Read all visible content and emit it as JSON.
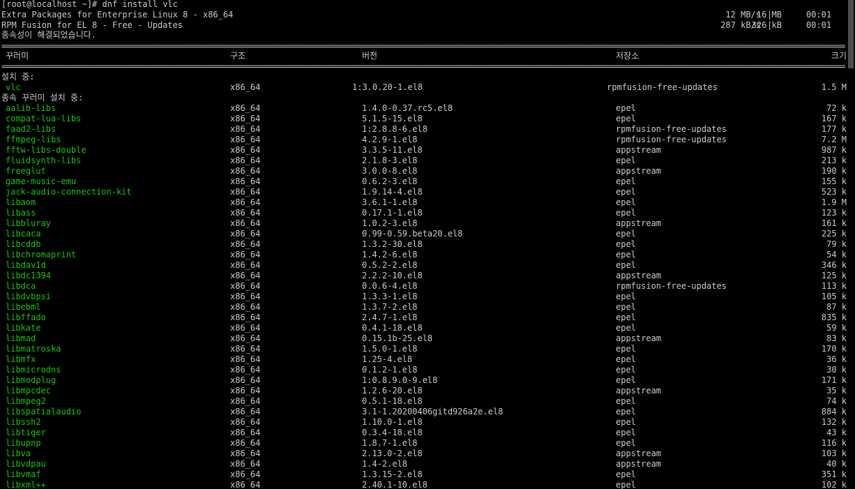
{
  "prompt": "[root@localhost ~]# dnf install vlc",
  "repos": [
    {
      "name": "Extra Packages for Enterprise Linux 8 - x86_64",
      "speed": "12 MB/s",
      "size": "16 MB",
      "time": "00:01"
    },
    {
      "name": "RPM Fusion for EL 8 - Free - Updates",
      "speed": "287 kB/s",
      "size": "326 kB",
      "time": "00:01"
    }
  ],
  "resolved": "종속성이 해결되었습니다.",
  "separator": "================================================================================================================================================================================================================================",
  "headers": {
    "package": "꾸러미",
    "arch": "구조",
    "version": "버전",
    "repo": "저장소",
    "size": "크기"
  },
  "installing_label": "설치 중:",
  "main_package": {
    "name": "vlc",
    "arch": "x86_64",
    "version": "1:3.0.20-1.el8",
    "repo": "rpmfusion-free-updates",
    "size": "1.5 M"
  },
  "deps_label": "종속 꾸러미 설치 중:",
  "deps": [
    {
      "name": "aalib-libs",
      "arch": "x86_64",
      "version": "1.4.0-0.37.rc5.el8",
      "repo": "epel",
      "size": "72 k"
    },
    {
      "name": "compat-lua-libs",
      "arch": "x86_64",
      "version": "5.1.5-15.el8",
      "repo": "epel",
      "size": "167 k"
    },
    {
      "name": "faad2-libs",
      "arch": "x86_64",
      "version": "1:2.8.8-6.el8",
      "repo": "rpmfusion-free-updates",
      "size": "177 k"
    },
    {
      "name": "ffmpeg-libs",
      "arch": "x86_64",
      "version": "4.2.9-1.el8",
      "repo": "rpmfusion-free-updates",
      "size": "7.2 M"
    },
    {
      "name": "fftw-libs-double",
      "arch": "x86_64",
      "version": "3.3.5-11.el8",
      "repo": "appstream",
      "size": "987 k"
    },
    {
      "name": "fluidsynth-libs",
      "arch": "x86_64",
      "version": "2.1.8-3.el8",
      "repo": "epel",
      "size": "213 k"
    },
    {
      "name": "freeglut",
      "arch": "x86_64",
      "version": "3.0.0-8.el8",
      "repo": "appstream",
      "size": "190 k"
    },
    {
      "name": "game-music-emu",
      "arch": "x86_64",
      "version": "0.6.2-3.el8",
      "repo": "epel",
      "size": "155 k"
    },
    {
      "name": "jack-audio-connection-kit",
      "arch": "x86_64",
      "version": "1.9.14-4.el8",
      "repo": "epel",
      "size": "523 k"
    },
    {
      "name": "libaom",
      "arch": "x86_64",
      "version": "3.6.1-1.el8",
      "repo": "epel",
      "size": "1.9 M"
    },
    {
      "name": "libass",
      "arch": "x86_64",
      "version": "0.17.1-1.el8",
      "repo": "epel",
      "size": "123 k"
    },
    {
      "name": "libbluray",
      "arch": "x86_64",
      "version": "1.0.2-3.el8",
      "repo": "appstream",
      "size": "161 k"
    },
    {
      "name": "libcaca",
      "arch": "x86_64",
      "version": "0.99-0.59.beta20.el8",
      "repo": "epel",
      "size": "225 k"
    },
    {
      "name": "libcddb",
      "arch": "x86_64",
      "version": "1.3.2-30.el8",
      "repo": "epel",
      "size": "79 k"
    },
    {
      "name": "libchromaprint",
      "arch": "x86_64",
      "version": "1.4.2-6.el8",
      "repo": "epel",
      "size": "54 k"
    },
    {
      "name": "libdav1d",
      "arch": "x86_64",
      "version": "0.5.2-2.el8",
      "repo": "epel",
      "size": "346 k"
    },
    {
      "name": "libdc1394",
      "arch": "x86_64",
      "version": "2.2.2-10.el8",
      "repo": "appstream",
      "size": "125 k"
    },
    {
      "name": "libdca",
      "arch": "x86_64",
      "version": "0.0.6-4.el8",
      "repo": "rpmfusion-free-updates",
      "size": "113 k"
    },
    {
      "name": "libdvbpsi",
      "arch": "x86_64",
      "version": "1.3.3-1.el8",
      "repo": "epel",
      "size": "105 k"
    },
    {
      "name": "libebml",
      "arch": "x86_64",
      "version": "1.3.7-2.el8",
      "repo": "epel",
      "size": "87 k"
    },
    {
      "name": "libffado",
      "arch": "x86_64",
      "version": "2.4.7-1.el8",
      "repo": "epel",
      "size": "835 k"
    },
    {
      "name": "libkate",
      "arch": "x86_64",
      "version": "0.4.1-18.el8",
      "repo": "epel",
      "size": "59 k"
    },
    {
      "name": "libmad",
      "arch": "x86_64",
      "version": "0.15.1b-25.el8",
      "repo": "appstream",
      "size": "83 k"
    },
    {
      "name": "libmatroska",
      "arch": "x86_64",
      "version": "1.5.0-1.el8",
      "repo": "epel",
      "size": "170 k"
    },
    {
      "name": "libmfx",
      "arch": "x86_64",
      "version": "1.25-4.el8",
      "repo": "epel",
      "size": "36 k"
    },
    {
      "name": "libmicrodns",
      "arch": "x86_64",
      "version": "0.1.2-1.el8",
      "repo": "epel",
      "size": "30 k"
    },
    {
      "name": "libmodplug",
      "arch": "x86_64",
      "version": "1:0.8.9.0-9.el8",
      "repo": "epel",
      "size": "171 k"
    },
    {
      "name": "libmpcdec",
      "arch": "x86_64",
      "version": "1.2.6-20.el8",
      "repo": "appstream",
      "size": "35 k"
    },
    {
      "name": "libmpeg2",
      "arch": "x86_64",
      "version": "0.5.1-18.el8",
      "repo": "epel",
      "size": "74 k"
    },
    {
      "name": "libspatialaudio",
      "arch": "x86_64",
      "version": "3.1-1.20200406gitd926a2e.el8",
      "repo": "epel",
      "size": "884 k"
    },
    {
      "name": "libssh2",
      "arch": "x86_64",
      "version": "1.10.0-1.el8",
      "repo": "epel",
      "size": "132 k"
    },
    {
      "name": "libtiger",
      "arch": "x86_64",
      "version": "0.3.4-18.el8",
      "repo": "epel",
      "size": "43 k"
    },
    {
      "name": "libupnp",
      "arch": "x86_64",
      "version": "1.8.7-1.el8",
      "repo": "epel",
      "size": "116 k"
    },
    {
      "name": "libva",
      "arch": "x86_64",
      "version": "2.13.0-2.el8",
      "repo": "appstream",
      "size": "103 k"
    },
    {
      "name": "libvdpau",
      "arch": "x86_64",
      "version": "1.4-2.el8",
      "repo": "appstream",
      "size": "40 k"
    },
    {
      "name": "libvmaf",
      "arch": "x86_64",
      "version": "1.3.15-2.el8",
      "repo": "epel",
      "size": "351 k"
    },
    {
      "name": "libxml++",
      "arch": "x86_64",
      "version": "2.40.1-10.el8",
      "repo": "epel",
      "size": "102 k"
    }
  ],
  "scrollbar": {
    "thumb_fraction": 0.14
  },
  "colors": {
    "background": "#000000",
    "text": "#cccccc",
    "package_name": "#16c60c",
    "scroll_thumb": "#4d4d4d"
  }
}
